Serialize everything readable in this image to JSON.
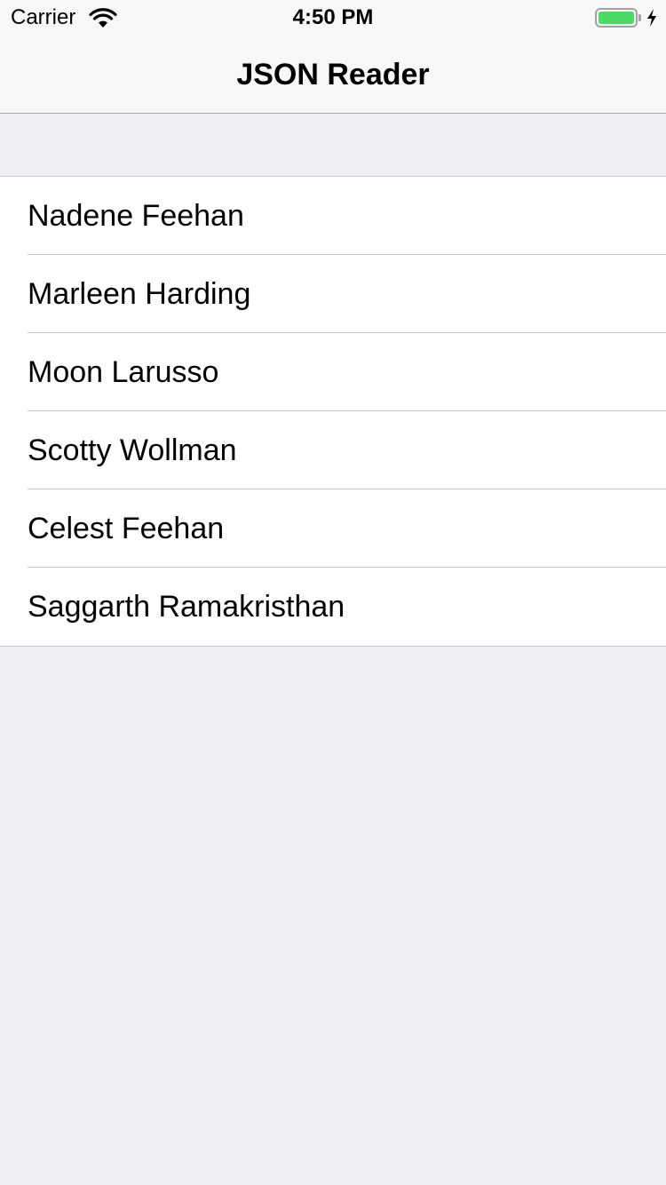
{
  "status_bar": {
    "carrier": "Carrier",
    "time": "4:50 PM",
    "battery_level": 1.0,
    "battery_color": "#4cd964"
  },
  "nav": {
    "title": "JSON Reader"
  },
  "list": {
    "items": [
      {
        "name": "Nadene Feehan"
      },
      {
        "name": "Marleen Harding"
      },
      {
        "name": "Moon Larusso"
      },
      {
        "name": "Scotty Wollman"
      },
      {
        "name": "Celest Feehan"
      },
      {
        "name": "Saggarth Ramakristhan"
      }
    ]
  },
  "icons": {
    "wifi": "wifi-icon",
    "battery": "battery-icon",
    "charging": "charging-bolt-icon"
  }
}
